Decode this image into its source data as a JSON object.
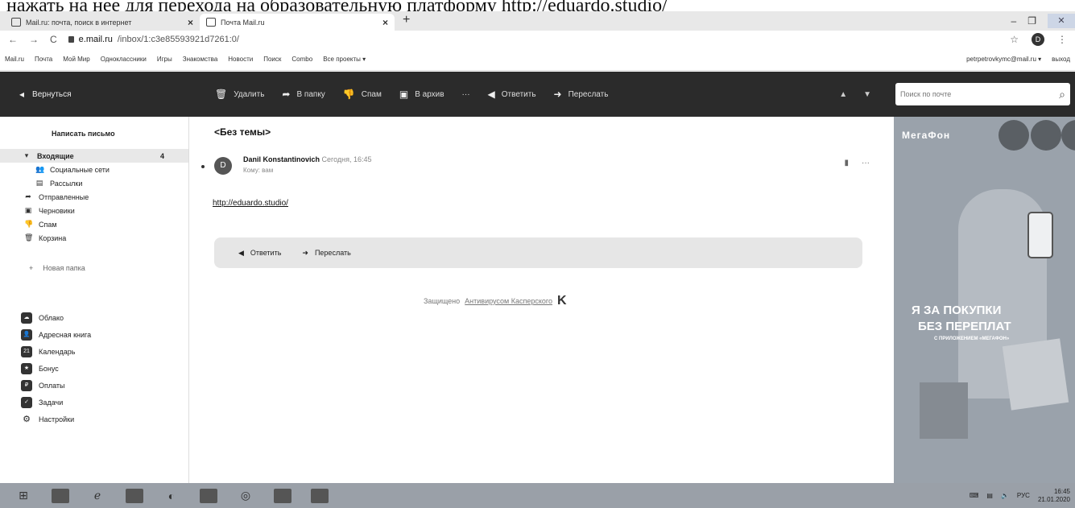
{
  "caption_text": "нажать на нее для перехода на образовательную платформу http://eduardo.studio/",
  "browser": {
    "tabs": [
      {
        "label": "Mail.ru: почта, поиск в интернет",
        "close": "×"
      },
      {
        "label": "Почта Mail.ru",
        "close": "×"
      }
    ],
    "new_tab": "+",
    "window_controls": {
      "minimize": "–",
      "restore": "❐",
      "close": "✕"
    },
    "url_host": "e.mail.ru",
    "url_path": "/inbox/1:c3e85593921d7261:0/",
    "nav": {
      "back": "←",
      "forward": "→",
      "reload": "C"
    },
    "star": "☆",
    "profile": "D",
    "menu": "⋮"
  },
  "portal_nav": {
    "links": [
      "Mail.ru",
      "Почта",
      "Мой Мир",
      "Одноклассники",
      "Игры",
      "Знакомства",
      "Новости",
      "Поиск",
      "Combo",
      "Все проекты ▾"
    ],
    "user_email": "petrpetrovkymc@mail.ru ▾",
    "logout": "выход"
  },
  "toolbar": {
    "back": "Вернуться",
    "actions": [
      {
        "label": "Удалить",
        "icon": "trash-icon"
      },
      {
        "label": "В папку",
        "icon": "folder-move-icon"
      },
      {
        "label": "Спам",
        "icon": "thumbs-down-icon"
      },
      {
        "label": "В архив",
        "icon": "archive-icon"
      },
      {
        "label": "···",
        "icon": "more-icon"
      },
      {
        "label": "Ответить",
        "icon": "reply-icon"
      },
      {
        "label": "Переслать",
        "icon": "forward-icon"
      }
    ],
    "prev": "▲",
    "next": "▼",
    "search_placeholder": "Поиск по почте"
  },
  "sidebar": {
    "compose": "Написать письмо",
    "folders": [
      {
        "label": "Входящие",
        "count": "4",
        "icon": "▾"
      },
      {
        "label": "Социальные сети",
        "icon": "👥"
      },
      {
        "label": "Рассылки",
        "icon": "▤"
      },
      {
        "label": "Отправленные",
        "icon": "➦"
      },
      {
        "label": "Черновики",
        "icon": "▣"
      },
      {
        "label": "Спам",
        "icon": "👎"
      },
      {
        "label": "Корзина",
        "icon": "🗑"
      }
    ],
    "new_folder": "Новая папка",
    "services": [
      {
        "label": "Облако",
        "glyph": "☁"
      },
      {
        "label": "Адресная книга",
        "glyph": "👤"
      },
      {
        "label": "Календарь",
        "glyph": "21"
      },
      {
        "label": "Бонус",
        "glyph": "★"
      },
      {
        "label": "Оплаты",
        "glyph": "₽"
      },
      {
        "label": "Задачи",
        "glyph": "✓"
      },
      {
        "label": "Настройки",
        "glyph": "⚙"
      }
    ]
  },
  "message": {
    "subject": "<Без темы>",
    "avatar_letter": "D",
    "sender": "Danil Konstantinovich",
    "time": "Сегодня, 16:45",
    "to": "Кому: вам",
    "body_link": "http://eduardo.studio/",
    "reply": "Ответить",
    "forward": "Переслать",
    "protected_prefix": "Защищено",
    "protected_link": "Антивирусом Касперского",
    "kaspersky_mark": "K"
  },
  "ad": {
    "brand": "МегаФон",
    "slogan_line1": "Я ЗА ПОКУПКИ",
    "slogan_line2": "БЕЗ ПЕРЕПЛАТ",
    "slogan_line3": "С ПРИЛОЖЕНИЕМ «МЕГАФОН»"
  },
  "taskbar": {
    "clock_time": "16:45",
    "clock_date": "21.01.2020",
    "lang": "РУС"
  }
}
